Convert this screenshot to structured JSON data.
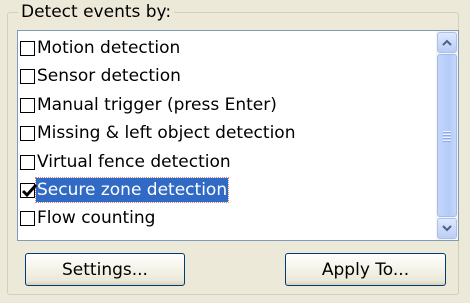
{
  "group": {
    "legend": "Detect events by:"
  },
  "events": [
    {
      "label": "Motion detection",
      "checked": false,
      "selected": false
    },
    {
      "label": "Sensor detection",
      "checked": false,
      "selected": false
    },
    {
      "label": "Manual trigger (press Enter)",
      "checked": false,
      "selected": false
    },
    {
      "label": "Missing & left object detection",
      "checked": false,
      "selected": false
    },
    {
      "label": "Virtual fence detection",
      "checked": false,
      "selected": false
    },
    {
      "label": "Secure zone detection",
      "checked": true,
      "selected": true
    },
    {
      "label": "Flow counting",
      "checked": false,
      "selected": false
    }
  ],
  "buttons": {
    "settings": "Settings...",
    "apply_to": "Apply To..."
  },
  "colors": {
    "selection": "#316ac5",
    "list_border": "#7f9db9"
  }
}
